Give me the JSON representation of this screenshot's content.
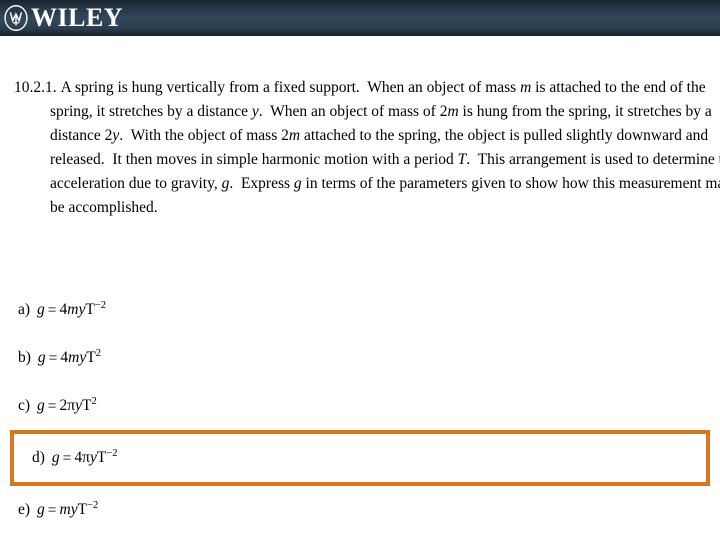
{
  "header": {
    "brand": "WILEY",
    "logo_icon": "wiley-emblem-icon",
    "bg_dark": "#16202a",
    "bg_mid": "#32485c"
  },
  "question": {
    "number": "10.2.1.",
    "text": "A spring is hung vertically from a fixed support.  When an object of mass m is attached to the end of the spring, it stretches by a distance y.  When an object of mass of 2m is hung from the spring, it stretches by a distance 2y.  With the object of mass 2m attached to the spring, the object is pulled slightly downward and released.  It then moves in simple harmonic motion with a period T.  This arrangement is used to determine the acceleration due to gravity, g.  Express g in terms of the parameters given to show how this measurement may be accomplished."
  },
  "options": [
    {
      "label": "a)",
      "formula": "g = 4myT−2",
      "highlighted": false
    },
    {
      "label": "b)",
      "formula": "g = 4myT2",
      "highlighted": false
    },
    {
      "label": "c)",
      "formula": "g = 2πyT2",
      "highlighted": false
    },
    {
      "label": "d)",
      "formula": "g = 4πyT−2",
      "highlighted": true
    },
    {
      "label": "e)",
      "formula": "g = myT−2",
      "highlighted": false
    }
  ],
  "highlight_color": "#d9761f"
}
